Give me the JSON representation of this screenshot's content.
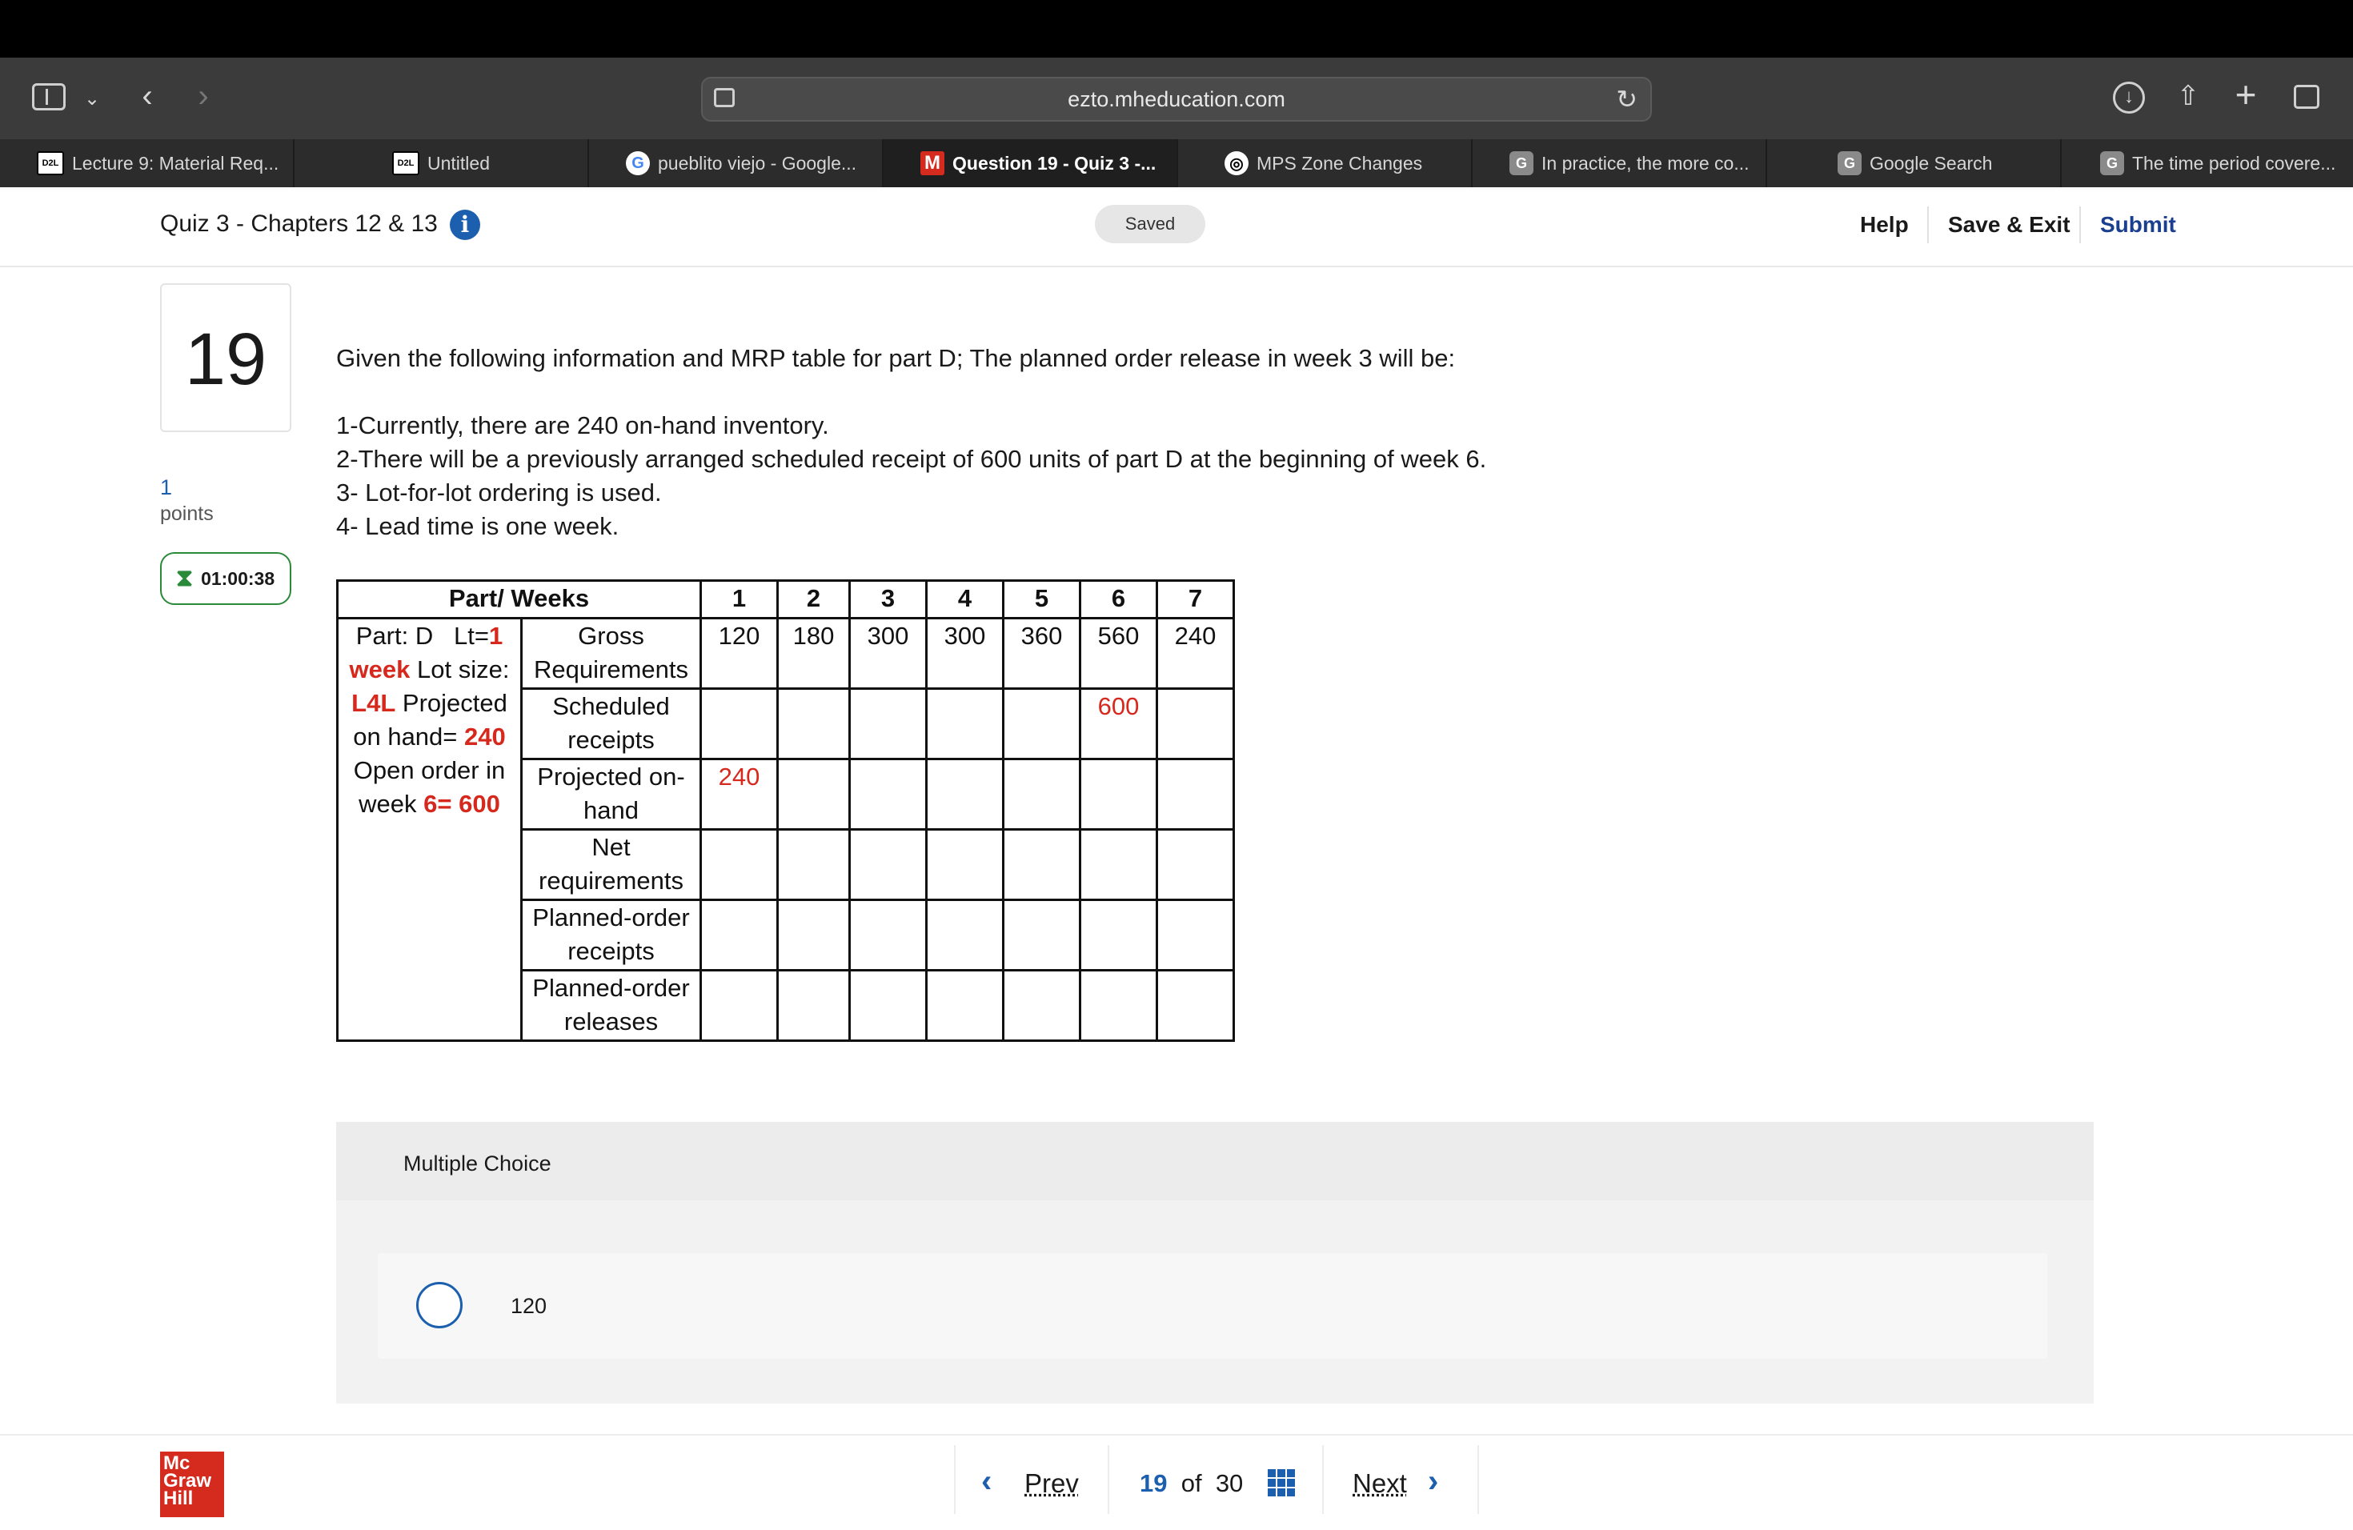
{
  "browser": {
    "url": "ezto.mheducation.com",
    "tabs": [
      {
        "label": "Lecture 9: Material Req...",
        "favicon": "D2L"
      },
      {
        "label": "Untitled",
        "favicon": "D2L"
      },
      {
        "label": "pueblito viejo - Google...",
        "favicon": "G"
      },
      {
        "label": "Question 19 - Quiz 3 -...",
        "favicon": "M"
      },
      {
        "label": "MPS Zone Changes",
        "favicon": "◎"
      },
      {
        "label": "In practice, the more co...",
        "favicon": "G"
      },
      {
        "label": "Google Search",
        "favicon": "G"
      },
      {
        "label": "The time period covere...",
        "favicon": "G"
      }
    ]
  },
  "header": {
    "quiz_title": "Quiz 3 - Chapters 12 & 13",
    "info_icon": "i",
    "saved": "Saved",
    "help": "Help",
    "save_exit": "Save & Exit",
    "submit": "Submit"
  },
  "question": {
    "number": "19",
    "points_value": "1",
    "points_label": "points",
    "timer": "01:00:38",
    "prompt": "Given the following information and MRP table for part D; The planned order release in week 3 will be:",
    "facts": [
      "1-Currently, there are 240 on-hand inventory.",
      "2-There will be a previously arranged scheduled receipt of 600 units of part D at the beginning of week 6.",
      "3- Lot-for-lot ordering is used.",
      "4- Lead time is one week."
    ]
  },
  "mrp_table": {
    "header_label": "Part/ Weeks",
    "weeks": [
      "1",
      "2",
      "3",
      "4",
      "5",
      "6",
      "7"
    ],
    "part_info": {
      "part": "Part: D",
      "lt_label": "Lt=",
      "lt_value": "1",
      "week_word": "week",
      "lot_size_label": "Lot size:",
      "lot_size_value": "L4L",
      "projected_label": "Projected",
      "on_hand_label": "on hand=",
      "on_hand_value": "240",
      "open_order_label": "Open order in",
      "week_label": "week",
      "open_order_week": "6=",
      "open_order_value": "600"
    },
    "rows": [
      {
        "label": "Gross Requirements",
        "values": [
          "120",
          "180",
          "300",
          "300",
          "360",
          "560",
          "240"
        ]
      },
      {
        "label": "Scheduled receipts",
        "values": [
          "",
          "",
          "",
          "",
          "",
          "600",
          ""
        ]
      },
      {
        "label": "Projected on-hand",
        "values": [
          "240",
          "",
          "",
          "",
          "",
          "",
          ""
        ]
      },
      {
        "label": "Net requirements",
        "values": [
          "",
          "",
          "",
          "",
          "",
          "",
          ""
        ]
      },
      {
        "label": "Planned-order receipts",
        "values": [
          "",
          "",
          "",
          "",
          "",
          "",
          ""
        ]
      },
      {
        "label": "Planned-order releases",
        "values": [
          "",
          "",
          "",
          "",
          "",
          "",
          ""
        ]
      }
    ]
  },
  "multiple_choice": {
    "label": "Multiple Choice",
    "options": [
      "120"
    ]
  },
  "footer": {
    "logo": [
      "Mc",
      "Graw",
      "Hill"
    ],
    "prev": "Prev",
    "current_page": "19",
    "of": "of",
    "total_pages": "30",
    "next": "Next"
  },
  "colors": {
    "accent": "#1b5fae",
    "highlight_red": "#d6281c",
    "timer_green": "#2a8a3a",
    "brand_red": "#d52b1e"
  }
}
